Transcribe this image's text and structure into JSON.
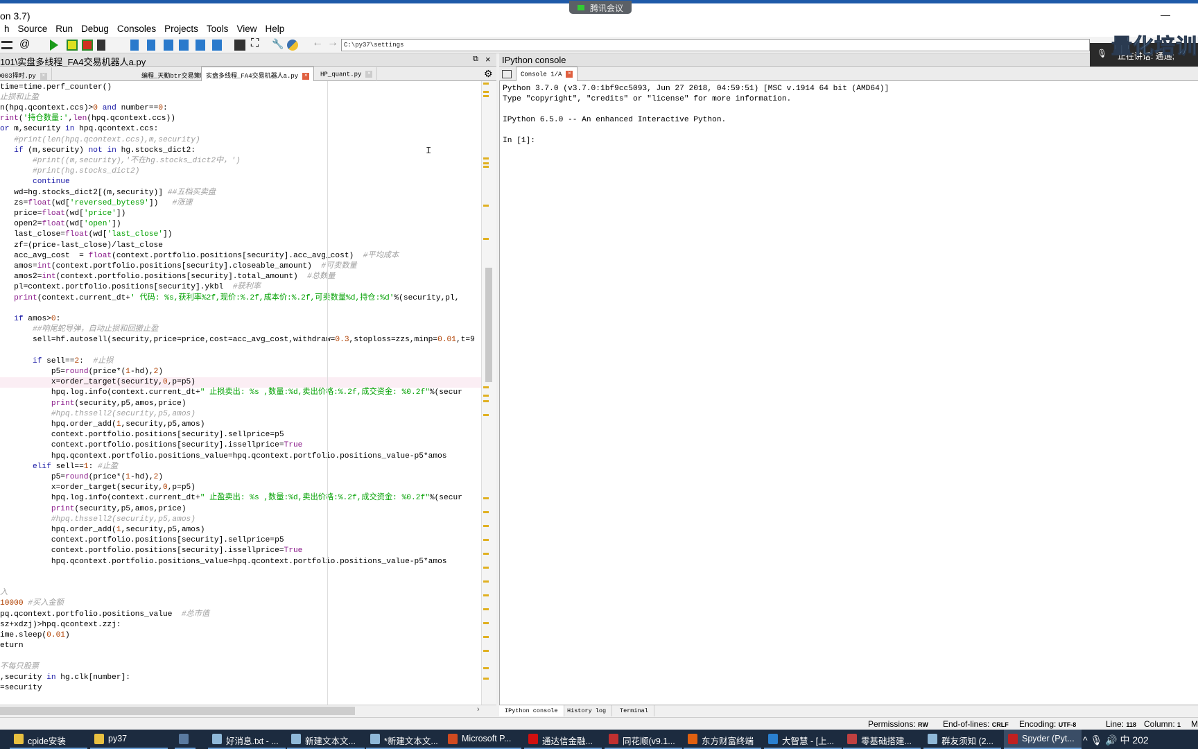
{
  "window": {
    "title": "on 3.7)",
    "minimize": "—"
  },
  "menu": [
    "h",
    "Source",
    "Run",
    "Debug",
    "Consoles",
    "Projects",
    "Tools",
    "View",
    "Help"
  ],
  "toolbar": {
    "path": "C:\\py37\\settings"
  },
  "editor": {
    "header": "101\\实盘多线程_FA4交易机器人a.py",
    "tabs": [
      {
        "label": "0003择时.py",
        "active": false
      },
      {
        "label": "编程_天勤btr交易策略_网格交易策略a.py",
        "active": false
      },
      {
        "label": "实盘多线程_FA4交易机器人a.py",
        "active": true
      },
      {
        "label": "HP_quant.py",
        "active": false
      }
    ],
    "close_glyph": "×"
  },
  "code": {
    "highlight_line": 28,
    "lines": [
      {
        "tokens": [
          [
            "p",
            "time=time.perf_counter()"
          ]
        ]
      },
      {
        "tokens": [
          [
            "c",
            "止损和止盈"
          ]
        ]
      },
      {
        "tokens": [
          [
            "p",
            "n(hpq.qcontext.ccs)>"
          ],
          [
            "n",
            "0"
          ],
          [
            "p",
            " "
          ],
          [
            "k",
            "and"
          ],
          [
            "p",
            " number=="
          ],
          [
            "n",
            "0"
          ],
          [
            "p",
            ":"
          ]
        ]
      },
      {
        "tokens": [
          [
            "b",
            "rint"
          ],
          [
            "p",
            "("
          ],
          [
            "s",
            "'持仓数量:'"
          ],
          [
            "p",
            ","
          ],
          [
            "b",
            "len"
          ],
          [
            "p",
            "(hpq.qcontext.ccs))"
          ]
        ]
      },
      {
        "tokens": [
          [
            "k",
            "or"
          ],
          [
            "p",
            " m,security "
          ],
          [
            "k",
            "in"
          ],
          [
            "p",
            " hpq.qcontext.ccs:"
          ]
        ]
      },
      {
        "tokens": [
          [
            "c",
            "   #print(len(hpq.qcontext.ccs),m,security)"
          ]
        ]
      },
      {
        "tokens": [
          [
            "p",
            "   "
          ],
          [
            "k",
            "if"
          ],
          [
            "p",
            " (m,security) "
          ],
          [
            "k",
            "not in"
          ],
          [
            "p",
            " hg.stocks_dict2:"
          ]
        ]
      },
      {
        "tokens": [
          [
            "c",
            "       #print((m,security),'不在hg.stocks_dict2中，')"
          ]
        ]
      },
      {
        "tokens": [
          [
            "c",
            "       #print(hg.stocks_dict2)"
          ]
        ]
      },
      {
        "tokens": [
          [
            "p",
            "       "
          ],
          [
            "k",
            "continue"
          ]
        ]
      },
      {
        "tokens": [
          [
            "p",
            "   wd=hg.stocks_dict2[(m,security)] "
          ],
          [
            "c",
            "##五档买卖盘"
          ]
        ]
      },
      {
        "tokens": [
          [
            "p",
            "   zs="
          ],
          [
            "b",
            "float"
          ],
          [
            "p",
            "(wd["
          ],
          [
            "s",
            "'reversed_bytes9'"
          ],
          [
            "p",
            "])   "
          ],
          [
            "c",
            "#涨速"
          ]
        ]
      },
      {
        "tokens": [
          [
            "p",
            "   price="
          ],
          [
            "b",
            "float"
          ],
          [
            "p",
            "(wd["
          ],
          [
            "s",
            "'price'"
          ],
          [
            "p",
            "])"
          ]
        ]
      },
      {
        "tokens": [
          [
            "p",
            "   open2="
          ],
          [
            "b",
            "float"
          ],
          [
            "p",
            "(wd["
          ],
          [
            "s",
            "'open'"
          ],
          [
            "p",
            "])"
          ]
        ]
      },
      {
        "tokens": [
          [
            "p",
            "   last_close="
          ],
          [
            "b",
            "float"
          ],
          [
            "p",
            "(wd["
          ],
          [
            "s",
            "'last_close'"
          ],
          [
            "p",
            "])"
          ]
        ]
      },
      {
        "tokens": [
          [
            "p",
            "   zf=(price-last_close)/last_close"
          ]
        ]
      },
      {
        "tokens": [
          [
            "p",
            "   acc_avg_cost  = "
          ],
          [
            "b",
            "float"
          ],
          [
            "p",
            "(context.portfolio.positions[security].acc_avg_cost)  "
          ],
          [
            "c",
            "#平均成本"
          ]
        ]
      },
      {
        "tokens": [
          [
            "p",
            "   amos="
          ],
          [
            "b",
            "int"
          ],
          [
            "p",
            "(context.portfolio.positions[security].closeable_amount)  "
          ],
          [
            "c",
            "#可卖数量"
          ]
        ]
      },
      {
        "tokens": [
          [
            "p",
            "   amos2="
          ],
          [
            "b",
            "int"
          ],
          [
            "p",
            "(context.portfolio.positions[security].total_amount)  "
          ],
          [
            "c",
            "#总数量"
          ]
        ]
      },
      {
        "tokens": [
          [
            "p",
            "   pl=context.portfolio.positions[security].ykbl  "
          ],
          [
            "c",
            "#获利率"
          ]
        ]
      },
      {
        "tokens": [
          [
            "p",
            "   "
          ],
          [
            "b",
            "print"
          ],
          [
            "p",
            "(context.current_dt+"
          ],
          [
            "s",
            "' 代码: %s,获利率%2f,现价:%.2f,成本价:%.2f,可卖数量%d,持仓:%d'"
          ],
          [
            "p",
            "%(security,pl,"
          ]
        ]
      },
      {
        "tokens": [
          [
            "p",
            ""
          ]
        ]
      },
      {
        "tokens": [
          [
            "p",
            "   "
          ],
          [
            "k",
            "if"
          ],
          [
            "p",
            " amos>"
          ],
          [
            "n",
            "0"
          ],
          [
            "p",
            ":"
          ]
        ]
      },
      {
        "tokens": [
          [
            "c",
            "       ##响尾蛇导弹，自动止损和回撤止盈"
          ]
        ]
      },
      {
        "tokens": [
          [
            "p",
            "       sell=hf.autosell(security,price=price,cost=acc_avg_cost,withdraw="
          ],
          [
            "n",
            "0.3"
          ],
          [
            "p",
            ",stoploss=zzs,minp="
          ],
          [
            "n",
            "0.01"
          ],
          [
            "p",
            ",t=9"
          ]
        ]
      },
      {
        "tokens": [
          [
            "p",
            ""
          ]
        ]
      },
      {
        "tokens": [
          [
            "p",
            "       "
          ],
          [
            "k",
            "if"
          ],
          [
            "p",
            " sell=="
          ],
          [
            "n",
            "2"
          ],
          [
            "p",
            ":  "
          ],
          [
            "c",
            "#止损"
          ]
        ]
      },
      {
        "tokens": [
          [
            "p",
            "           p5="
          ],
          [
            "b",
            "round"
          ],
          [
            "p",
            "(price*("
          ],
          [
            "n",
            "1"
          ],
          [
            "p",
            "-hd),"
          ],
          [
            "n",
            "2"
          ],
          [
            "p",
            ")"
          ]
        ]
      },
      {
        "tokens": [
          [
            "p",
            "           x=order_target(security,"
          ],
          [
            "n",
            "0"
          ],
          [
            "p",
            ",p=p5)"
          ]
        ]
      },
      {
        "tokens": [
          [
            "p",
            "           hpq.log.info(context.current_dt+"
          ],
          [
            "s",
            "\" 止损卖出: %s ,数量:%d,卖出价格:%.2f,成交资金: %0.2f\""
          ],
          [
            "p",
            "%(secur"
          ]
        ]
      },
      {
        "tokens": [
          [
            "p",
            "           "
          ],
          [
            "b",
            "print"
          ],
          [
            "p",
            "(security,p5,amos,price)"
          ]
        ]
      },
      {
        "tokens": [
          [
            "c",
            "           #hpq.thssell2(security,p5,amos)"
          ]
        ]
      },
      {
        "tokens": [
          [
            "p",
            "           hpq.order_add("
          ],
          [
            "n",
            "1"
          ],
          [
            "p",
            ",security,p5,amos)"
          ]
        ]
      },
      {
        "tokens": [
          [
            "p",
            "           context.portfolio.positions[security].sellprice=p5"
          ]
        ]
      },
      {
        "tokens": [
          [
            "p",
            "           context.portfolio.positions[security].issellprice="
          ],
          [
            "b",
            "True"
          ]
        ]
      },
      {
        "tokens": [
          [
            "p",
            "           hpq.qcontext.portfolio.positions_value=hpq.qcontext.portfolio.positions_value-p5*amos"
          ]
        ]
      },
      {
        "tokens": [
          [
            "p",
            "       "
          ],
          [
            "k",
            "elif"
          ],
          [
            "p",
            " sell=="
          ],
          [
            "n",
            "1"
          ],
          [
            "p",
            ": "
          ],
          [
            "c",
            "#止盈"
          ]
        ]
      },
      {
        "tokens": [
          [
            "p",
            "           p5="
          ],
          [
            "b",
            "round"
          ],
          [
            "p",
            "(price*("
          ],
          [
            "n",
            "1"
          ],
          [
            "p",
            "-hd),"
          ],
          [
            "n",
            "2"
          ],
          [
            "p",
            ")"
          ]
        ]
      },
      {
        "tokens": [
          [
            "p",
            "           x=order_target(security,"
          ],
          [
            "n",
            "0"
          ],
          [
            "p",
            ",p=p5)"
          ]
        ]
      },
      {
        "tokens": [
          [
            "p",
            "           hpq.log.info(context.current_dt+"
          ],
          [
            "s",
            "\" 止盈卖出: %s ,数量:%d,卖出价格:%.2f,成交资金: %0.2f\""
          ],
          [
            "p",
            "%(secur"
          ]
        ]
      },
      {
        "tokens": [
          [
            "p",
            "           "
          ],
          [
            "b",
            "print"
          ],
          [
            "p",
            "(security,p5,amos,price)"
          ]
        ]
      },
      {
        "tokens": [
          [
            "c",
            "           #hpq.thssell2(security,p5,amos)"
          ]
        ]
      },
      {
        "tokens": [
          [
            "p",
            "           hpq.order_add("
          ],
          [
            "n",
            "1"
          ],
          [
            "p",
            ",security,p5,amos)"
          ]
        ]
      },
      {
        "tokens": [
          [
            "p",
            "           context.portfolio.positions[security].sellprice=p5"
          ]
        ]
      },
      {
        "tokens": [
          [
            "p",
            "           context.portfolio.positions[security].issellprice="
          ],
          [
            "b",
            "True"
          ]
        ]
      },
      {
        "tokens": [
          [
            "p",
            "           hpq.qcontext.portfolio.positions_value=hpq.qcontext.portfolio.positions_value-p5*amos"
          ]
        ]
      },
      {
        "tokens": [
          [
            "p",
            ""
          ]
        ]
      },
      {
        "tokens": [
          [
            "p",
            ""
          ]
        ]
      },
      {
        "tokens": [
          [
            "c",
            "入"
          ]
        ]
      },
      {
        "tokens": [
          [
            "n",
            "10000"
          ],
          [
            "p",
            " "
          ],
          [
            "c",
            "#买入金额"
          ]
        ]
      },
      {
        "tokens": [
          [
            "p",
            "pq.qcontext.portfolio.positions_value  "
          ],
          [
            "c",
            "#总市值"
          ]
        ]
      },
      {
        "tokens": [
          [
            "p",
            "sz+xdzj)>hpq.qcontext.zzj:"
          ]
        ]
      },
      {
        "tokens": [
          [
            "p",
            "ime.sleep("
          ],
          [
            "n",
            "0.01"
          ],
          [
            "p",
            ")"
          ]
        ]
      },
      {
        "tokens": [
          [
            "p",
            "eturn"
          ]
        ]
      },
      {
        "tokens": [
          [
            "p",
            ""
          ]
        ]
      },
      {
        "tokens": [
          [
            "c",
            "不每只股票"
          ]
        ]
      },
      {
        "tokens": [
          [
            "p",
            ",security "
          ],
          [
            "k",
            "in"
          ],
          [
            "p",
            " hg.clk[number]:"
          ]
        ]
      },
      {
        "tokens": [
          [
            "p",
            "=security"
          ]
        ]
      }
    ]
  },
  "console": {
    "header": "IPython console",
    "tab": "Console 1/A",
    "lines": [
      "Python 3.7.0 (v3.7.0:1bf9cc5093, Jun 27 2018, 04:59:51) [MSC v.1914 64 bit (AMD64)]",
      "Type \"copyright\", \"credits\" or \"license\" for more information.",
      "IPython 6.5.0 -- An enhanced Interactive Python.",
      "In [1]:"
    ],
    "bottom_tabs": [
      "IPython console",
      "History log",
      "Terminal"
    ]
  },
  "status": {
    "permissions_label": "Permissions:",
    "permissions": "RW",
    "eol_label": "End-of-lines:",
    "eol": "CRLF",
    "encoding_label": "Encoding:",
    "encoding": "UTF-8",
    "line_label": "Line:",
    "line": "118",
    "column_label": "Column:",
    "column": "1",
    "extra": "M"
  },
  "taskbar": {
    "items": [
      {
        "label": "cpide安装",
        "color": "#e8c040"
      },
      {
        "label": "py37",
        "color": "#e8c040"
      },
      {
        "label": "",
        "color": "#5a7aa0"
      },
      {
        "label": "好消息.txt - ...",
        "color": "#8fb8d8"
      },
      {
        "label": "新建文本文...",
        "color": "#8fb8d8"
      },
      {
        "label": "*新建文本文...",
        "color": "#8fb8d8"
      },
      {
        "label": "Microsoft P...",
        "color": "#d04a20"
      },
      {
        "label": "通达信金融...",
        "color": "#d01010"
      },
      {
        "label": "同花顺(v9.1...",
        "color": "#c03030"
      },
      {
        "label": "东方财富终端",
        "color": "#e06010"
      },
      {
        "label": "大智慧 - [上...",
        "color": "#2a80d0"
      },
      {
        "label": "零基础搭建...",
        "color": "#c04040"
      },
      {
        "label": "群友须知 (2...",
        "color": "#8fb8d8"
      },
      {
        "label": "Spyder (Pyt...",
        "color": "#c02020",
        "active": true
      }
    ],
    "tray": "^  🎙      🔊 中  202"
  },
  "overlay": {
    "meeting": "腾讯会议",
    "speaking": "正在讲话: 通通;",
    "watermark": "量化培训"
  }
}
